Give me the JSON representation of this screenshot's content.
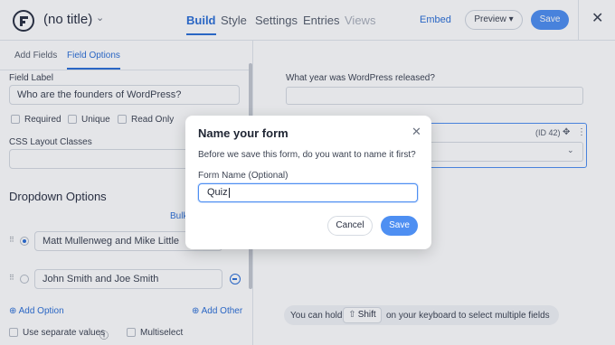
{
  "header": {
    "form_title": "(no title)",
    "nav": [
      "Build",
      "Style",
      "Settings",
      "Entries",
      "Views"
    ],
    "embed": "Embed",
    "preview": "Preview ▾",
    "save": "Save",
    "close": "✕"
  },
  "left_panel": {
    "tabs": [
      "Add Fields",
      "Field Options"
    ],
    "field_label_title": "Field Label",
    "field_label_value": "Who are the founders of WordPress?",
    "checkboxes": [
      "Required",
      "Unique",
      "Read Only"
    ],
    "css_classes_label": "CSS Layout Classes",
    "dropdown_options_title": "Dropdown Options",
    "bulk_edit": "Bulk",
    "options": [
      {
        "label": "Matt Mullenweg and Mike Little",
        "selected": true
      },
      {
        "label": "John Smith and Joe Smith",
        "selected": false
      }
    ],
    "add_option": "⊕ Add Option",
    "add_other": "⊕ Add Other",
    "use_separate_values": "Use separate values",
    "info_icon": "ⓘ",
    "multiselect": "Multiselect"
  },
  "canvas": {
    "question_label": "What year was WordPress released?",
    "field_id": "(ID 42)",
    "hint_before": "You can hold",
    "shift_key": "Shift",
    "shift_glyph": "⇧",
    "hint_after": "on your keyboard to select multiple fields"
  },
  "modal": {
    "title": "Name your form",
    "description": "Before we save this form, do you want to name it first?",
    "input_label": "Form Name (Optional)",
    "input_value": "Quiz",
    "cancel": "Cancel",
    "save": "Save",
    "close": "✕"
  },
  "colors": {
    "accent": "#2c6fd6",
    "primary_button": "#4e8ff2"
  }
}
